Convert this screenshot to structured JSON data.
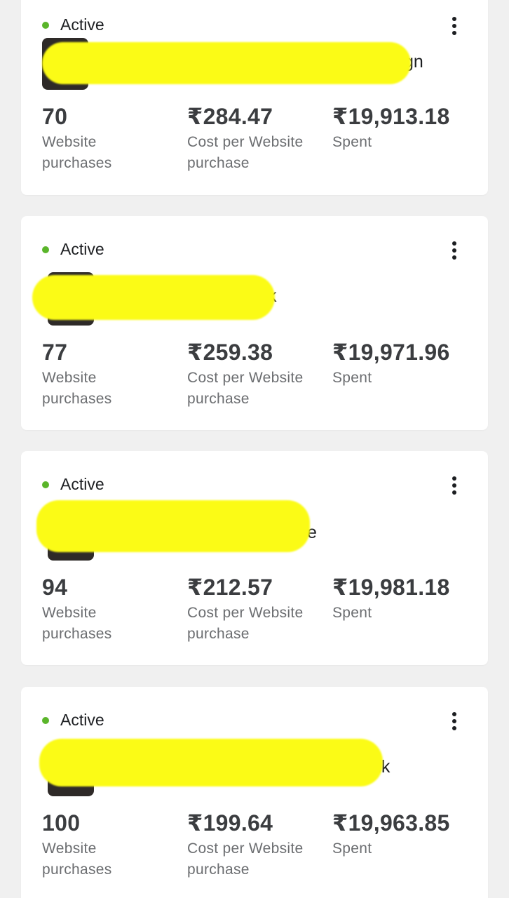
{
  "campaigns": [
    {
      "status": "Active",
      "name_visible_suffix": "gn",
      "purchases": "70",
      "purchases_label": "Website purchases",
      "cost_per_purchase": "₹284.47",
      "cost_label": "Cost per Website purchase",
      "spent": "₹19,913.18",
      "spent_label": "Spent"
    },
    {
      "status": "Active",
      "name_visible_suffix": "k",
      "purchases": "77",
      "purchases_label": "Website purchases",
      "cost_per_purchase": "₹259.38",
      "cost_label": "Cost per Website purchase",
      "spent": "₹19,971.96",
      "spent_label": "Spent"
    },
    {
      "status": "Active",
      "name_visible_suffix": "e",
      "purchases": "94",
      "purchases_label": "Website purchases",
      "cost_per_purchase": "₹212.57",
      "cost_label": "Cost per Website purchase",
      "spent": "₹19,981.18",
      "spent_label": "Spent"
    },
    {
      "status": "Active",
      "name_visible_suffix": "nk",
      "purchases": "100",
      "purchases_label": "Website purchases",
      "cost_per_purchase": "₹199.64",
      "cost_label": "Cost per Website purchase",
      "spent": "₹19,963.85",
      "spent_label": "Spent"
    }
  ],
  "colors": {
    "active_green": "#5ab52a",
    "redaction_yellow": "#fbfb16",
    "page_background": "#f0f0f0",
    "card_background": "#ffffff"
  },
  "icons": [
    "more-options-icon",
    "status-dot-icon"
  ]
}
